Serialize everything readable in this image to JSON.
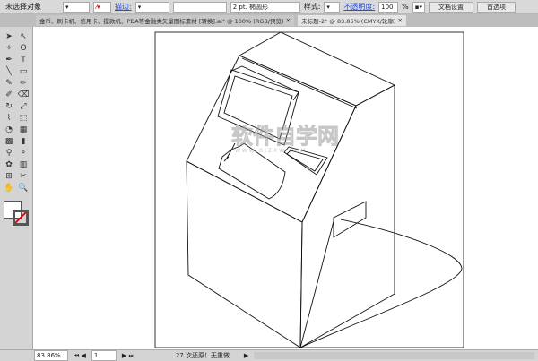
{
  "control_bar": {
    "selection": "未选择对象",
    "stroke_label": "描边:",
    "stroke_profile": "2 pt. 椭圆形",
    "style_label": "样式:",
    "opacity_label": "不透明度:",
    "opacity_value": "100",
    "opacity_unit": "%",
    "doc_setup": "文档设置",
    "preferences": "首选项"
  },
  "tabs": [
    {
      "label": "金币、刷卡机、信用卡、提款机、PDA等金融类矢量图标素材 [转换].ai* @ 100% (RGB/预览)",
      "active": false
    },
    {
      "label": "未标题-2* @ 83.86% (CMYK/轮廓)",
      "active": true
    }
  ],
  "tools": [
    "selection-icon",
    "direct-selection-icon",
    "magic-wand-icon",
    "lasso-icon",
    "pen-icon",
    "type-icon",
    "line-icon",
    "rectangle-icon",
    "paintbrush-icon",
    "pencil-icon",
    "blob-brush-icon",
    "eraser-icon",
    "rotate-icon",
    "scale-icon",
    "warp-icon",
    "free-transform-icon",
    "shape-builder-icon",
    "perspective-icon",
    "mesh-icon",
    "gradient-icon",
    "eyedropper-icon",
    "blend-icon",
    "symbol-sprayer-icon",
    "column-graph-icon",
    "artboard-icon",
    "slice-icon",
    "hand-icon",
    "zoom-icon"
  ],
  "tool_glyphs": [
    "➤",
    "↖",
    "✧",
    "ʘ",
    "✒",
    "T",
    "╲",
    "▭",
    "✎",
    "✏",
    "✐",
    "⌫",
    "↻",
    "⤢",
    "⌇",
    "⬚",
    "◔",
    "▦",
    "▩",
    "▮",
    "⚲",
    "⚬",
    "✿",
    "▥",
    "⊞",
    "✂",
    "✋",
    "🔍"
  ],
  "status": {
    "zoom": "83.86%",
    "page": "1",
    "message": "27 次还原！无重做"
  },
  "watermark": {
    "main": "软件自学网",
    "sub": "WWW.RJZXW.COM"
  }
}
